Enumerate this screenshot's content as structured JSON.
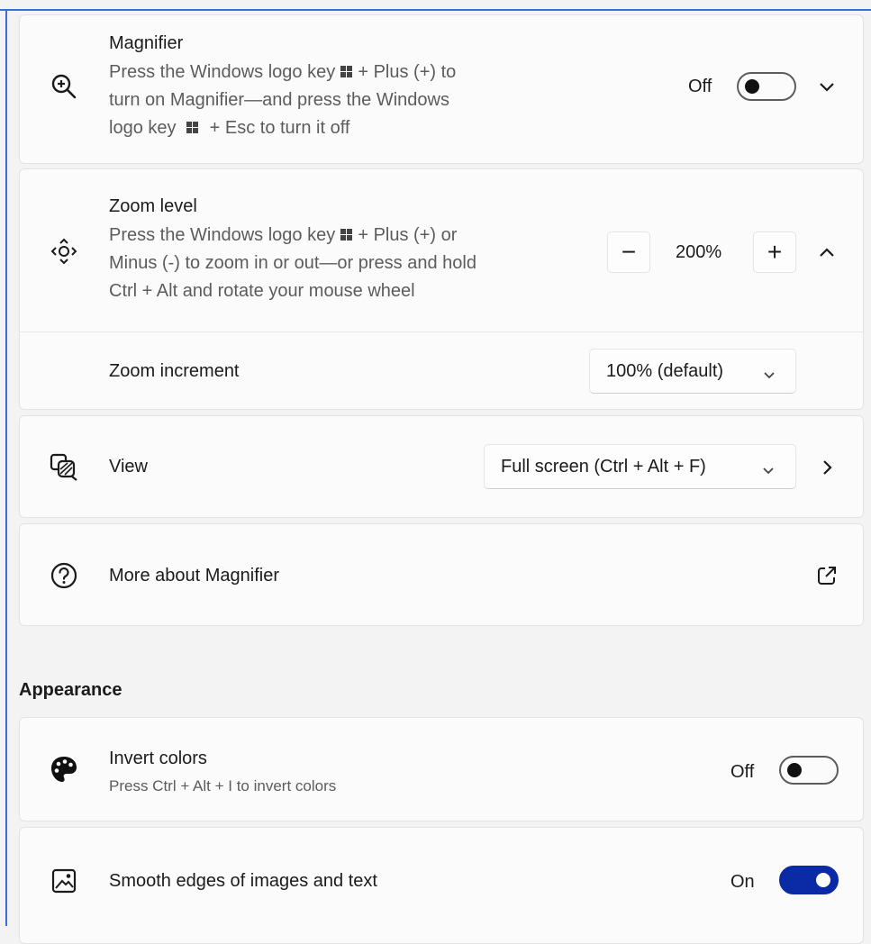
{
  "magnifier": {
    "title": "Magnifier",
    "desc_line1_a": "Press the Windows logo key",
    "desc_line1_b": "+ Plus (+) to",
    "desc_line2": "turn on Magnifier—and press the Windows",
    "desc_line3_a": "logo key",
    "desc_line3_b": "+ Esc to turn it off",
    "state": "Off",
    "icon": "zoom-in-icon"
  },
  "zoom_level": {
    "title": "Zoom level",
    "desc_line1_a": "Press the Windows logo key",
    "desc_line1_b": "+ Plus (+) or",
    "desc_line2": "Minus (-) to zoom in or out—or press and hold",
    "desc_line3": "Ctrl + Alt and rotate your mouse wheel",
    "value": "200%",
    "decrease": "−",
    "increase": "+",
    "icon": "zoom-move-icon"
  },
  "zoom_increment": {
    "label": "Zoom increment",
    "selected": "100% (default)"
  },
  "view": {
    "label": "View",
    "selected": "Full screen (Ctrl + Alt + F)",
    "icon": "view-icon"
  },
  "more_about": {
    "label": "More about Magnifier",
    "icon": "help-icon",
    "link_icon": "open-external-icon"
  },
  "appearance": {
    "heading": "Appearance",
    "invert": {
      "title": "Invert colors",
      "desc": "Press Ctrl + Alt + I to invert colors",
      "state": "Off",
      "icon": "palette-icon"
    },
    "smooth": {
      "title": "Smooth edges of images and text",
      "state": "On",
      "icon": "image-icon"
    }
  },
  "colors": {
    "accent": "#0a2aa6",
    "frame": "#3a6fd8"
  }
}
